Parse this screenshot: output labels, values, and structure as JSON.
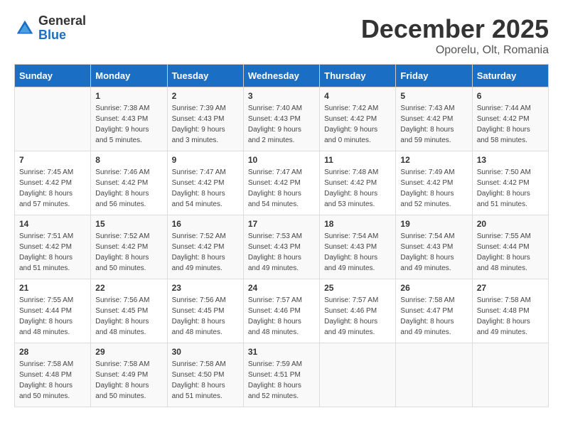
{
  "logo": {
    "general": "General",
    "blue": "Blue"
  },
  "title": {
    "month": "December 2025",
    "location": "Oporelu, Olt, Romania"
  },
  "headers": [
    "Sunday",
    "Monday",
    "Tuesday",
    "Wednesday",
    "Thursday",
    "Friday",
    "Saturday"
  ],
  "weeks": [
    [
      {
        "day": "",
        "info": ""
      },
      {
        "day": "1",
        "info": "Sunrise: 7:38 AM\nSunset: 4:43 PM\nDaylight: 9 hours\nand 5 minutes."
      },
      {
        "day": "2",
        "info": "Sunrise: 7:39 AM\nSunset: 4:43 PM\nDaylight: 9 hours\nand 3 minutes."
      },
      {
        "day": "3",
        "info": "Sunrise: 7:40 AM\nSunset: 4:43 PM\nDaylight: 9 hours\nand 2 minutes."
      },
      {
        "day": "4",
        "info": "Sunrise: 7:42 AM\nSunset: 4:42 PM\nDaylight: 9 hours\nand 0 minutes."
      },
      {
        "day": "5",
        "info": "Sunrise: 7:43 AM\nSunset: 4:42 PM\nDaylight: 8 hours\nand 59 minutes."
      },
      {
        "day": "6",
        "info": "Sunrise: 7:44 AM\nSunset: 4:42 PM\nDaylight: 8 hours\nand 58 minutes."
      }
    ],
    [
      {
        "day": "7",
        "info": "Sunrise: 7:45 AM\nSunset: 4:42 PM\nDaylight: 8 hours\nand 57 minutes."
      },
      {
        "day": "8",
        "info": "Sunrise: 7:46 AM\nSunset: 4:42 PM\nDaylight: 8 hours\nand 56 minutes."
      },
      {
        "day": "9",
        "info": "Sunrise: 7:47 AM\nSunset: 4:42 PM\nDaylight: 8 hours\nand 54 minutes."
      },
      {
        "day": "10",
        "info": "Sunrise: 7:47 AM\nSunset: 4:42 PM\nDaylight: 8 hours\nand 54 minutes."
      },
      {
        "day": "11",
        "info": "Sunrise: 7:48 AM\nSunset: 4:42 PM\nDaylight: 8 hours\nand 53 minutes."
      },
      {
        "day": "12",
        "info": "Sunrise: 7:49 AM\nSunset: 4:42 PM\nDaylight: 8 hours\nand 52 minutes."
      },
      {
        "day": "13",
        "info": "Sunrise: 7:50 AM\nSunset: 4:42 PM\nDaylight: 8 hours\nand 51 minutes."
      }
    ],
    [
      {
        "day": "14",
        "info": "Sunrise: 7:51 AM\nSunset: 4:42 PM\nDaylight: 8 hours\nand 51 minutes."
      },
      {
        "day": "15",
        "info": "Sunrise: 7:52 AM\nSunset: 4:42 PM\nDaylight: 8 hours\nand 50 minutes."
      },
      {
        "day": "16",
        "info": "Sunrise: 7:52 AM\nSunset: 4:42 PM\nDaylight: 8 hours\nand 49 minutes."
      },
      {
        "day": "17",
        "info": "Sunrise: 7:53 AM\nSunset: 4:43 PM\nDaylight: 8 hours\nand 49 minutes."
      },
      {
        "day": "18",
        "info": "Sunrise: 7:54 AM\nSunset: 4:43 PM\nDaylight: 8 hours\nand 49 minutes."
      },
      {
        "day": "19",
        "info": "Sunrise: 7:54 AM\nSunset: 4:43 PM\nDaylight: 8 hours\nand 49 minutes."
      },
      {
        "day": "20",
        "info": "Sunrise: 7:55 AM\nSunset: 4:44 PM\nDaylight: 8 hours\nand 48 minutes."
      }
    ],
    [
      {
        "day": "21",
        "info": "Sunrise: 7:55 AM\nSunset: 4:44 PM\nDaylight: 8 hours\nand 48 minutes."
      },
      {
        "day": "22",
        "info": "Sunrise: 7:56 AM\nSunset: 4:45 PM\nDaylight: 8 hours\nand 48 minutes."
      },
      {
        "day": "23",
        "info": "Sunrise: 7:56 AM\nSunset: 4:45 PM\nDaylight: 8 hours\nand 48 minutes."
      },
      {
        "day": "24",
        "info": "Sunrise: 7:57 AM\nSunset: 4:46 PM\nDaylight: 8 hours\nand 48 minutes."
      },
      {
        "day": "25",
        "info": "Sunrise: 7:57 AM\nSunset: 4:46 PM\nDaylight: 8 hours\nand 49 minutes."
      },
      {
        "day": "26",
        "info": "Sunrise: 7:58 AM\nSunset: 4:47 PM\nDaylight: 8 hours\nand 49 minutes."
      },
      {
        "day": "27",
        "info": "Sunrise: 7:58 AM\nSunset: 4:48 PM\nDaylight: 8 hours\nand 49 minutes."
      }
    ],
    [
      {
        "day": "28",
        "info": "Sunrise: 7:58 AM\nSunset: 4:48 PM\nDaylight: 8 hours\nand 50 minutes."
      },
      {
        "day": "29",
        "info": "Sunrise: 7:58 AM\nSunset: 4:49 PM\nDaylight: 8 hours\nand 50 minutes."
      },
      {
        "day": "30",
        "info": "Sunrise: 7:58 AM\nSunset: 4:50 PM\nDaylight: 8 hours\nand 51 minutes."
      },
      {
        "day": "31",
        "info": "Sunrise: 7:59 AM\nSunset: 4:51 PM\nDaylight: 8 hours\nand 52 minutes."
      },
      {
        "day": "",
        "info": ""
      },
      {
        "day": "",
        "info": ""
      },
      {
        "day": "",
        "info": ""
      }
    ]
  ]
}
